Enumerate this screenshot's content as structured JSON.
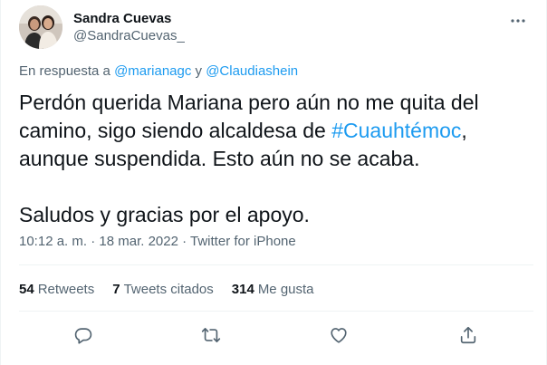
{
  "author": {
    "display_name": "Sandra Cuevas",
    "handle": "@SandraCuevas_",
    "avatar_icon": "profile-photo"
  },
  "reply": {
    "prefix": "En respuesta a ",
    "mention_1": "@marianagc",
    "joiner": " y ",
    "mention_2": "@Claudiashein"
  },
  "tweet": {
    "line_1": "Perdón querida Mariana pero aún no me quita del camino, sigo siendo alcaldesa de ",
    "hashtag": "#Cuauhtémoc",
    "line_2": ", aunque suspendida. Esto aún no se acaba.\n\nSaludos y gracias por el apoyo."
  },
  "meta": {
    "time": "10:12 a. m.",
    "separator_1": " · ",
    "date": "18 mar. 2022",
    "separator_2": " · ",
    "source": "Twitter for iPhone"
  },
  "stats": {
    "retweets_count": "54",
    "retweets_label": "Retweets",
    "quotes_count": "7",
    "quotes_label": "Tweets citados",
    "likes_count": "314",
    "likes_label": "Me gusta"
  },
  "icons": {
    "more": "more-dots-icon",
    "reply": "reply-icon",
    "retweet": "retweet-icon",
    "like": "heart-icon",
    "share": "share-icon"
  },
  "colors": {
    "accent": "#1d9bf0",
    "text": "#0f1419",
    "secondary": "#536471",
    "divider": "#eff3f4"
  }
}
